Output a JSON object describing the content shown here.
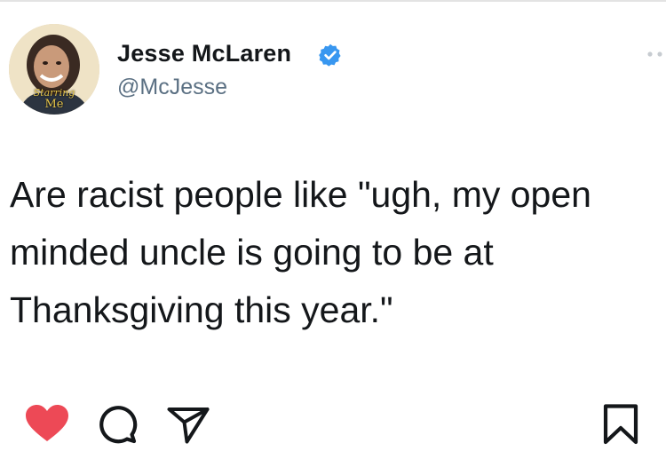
{
  "author": {
    "display_name": "Jesse McLaren",
    "handle": "@McJesse",
    "verified": true,
    "avatar_caption": [
      "Starring",
      "Me"
    ]
  },
  "tweet": {
    "lines": [
      "Are racist people like \"ugh, my open",
      "minded uncle is going to be at",
      "Thanksgiving this year.\""
    ]
  },
  "actions": [
    "like",
    "comment",
    "share",
    "save"
  ],
  "colors": {
    "text": "#14171a",
    "handle": "#5b7083",
    "like_heart": "#ed4956",
    "verified_badge": "#3897f0"
  },
  "icons": {
    "verified": "verified-badge-icon",
    "more": "more-dots-icon",
    "like": "heart-icon",
    "comment": "comment-bubble-icon",
    "share": "paper-plane-icon",
    "save": "bookmark-icon"
  }
}
